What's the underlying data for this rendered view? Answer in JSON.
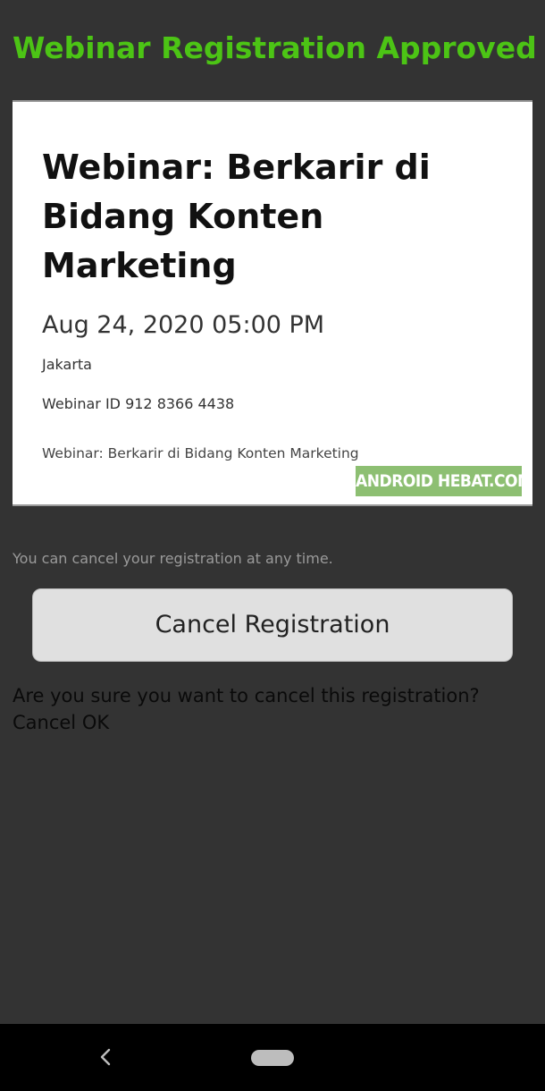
{
  "header": {
    "title": "Webinar Registration Approved"
  },
  "event": {
    "title": "Webinar: Berkarir di Bidang Konten Marketing",
    "datetime": "Aug 24, 2020 05:00 PM",
    "location": "Jakarta",
    "webinar_id": "Webinar ID 912 8366 4438",
    "description": "Webinar: Berkarir di Bidang Konten Marketing"
  },
  "watermark": {
    "text": "ANDROID HEBAT.COM"
  },
  "cancel": {
    "note": "You can cancel your registration at any time.",
    "button_label": "Cancel Registration",
    "confirm_question": "Are you sure you want to cancel this registration?",
    "confirm_cancel_label": "Cancel",
    "confirm_ok_label": "OK"
  },
  "colors": {
    "background": "#333333",
    "title_accent": "#4cc415",
    "card": "#ffffff",
    "button": "#e0e0e0",
    "watermark": "#8dbf72",
    "nav_bar": "#000000"
  },
  "icons": {
    "back": "chevron-left-icon",
    "home": "home-pill-icon"
  }
}
